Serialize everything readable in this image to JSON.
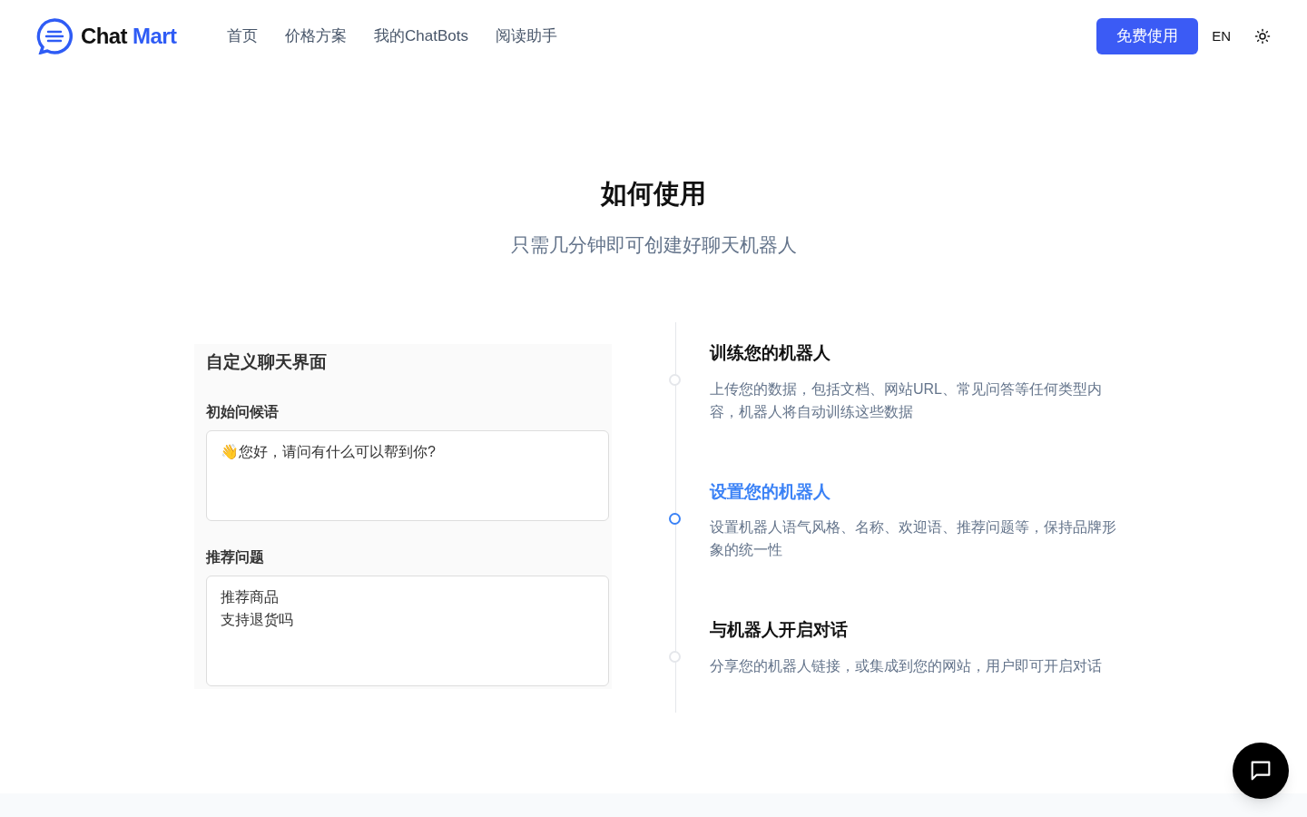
{
  "header": {
    "logo": {
      "word_1": "Chat",
      "word_2": "Mart"
    },
    "nav": [
      {
        "label": "首页"
      },
      {
        "label": "价格方案"
      },
      {
        "label": "我的ChatBots"
      },
      {
        "label": "阅读助手"
      }
    ],
    "cta": "免费使用",
    "language": "EN"
  },
  "section": {
    "title": "如何使用",
    "subtitle": "只需几分钟即可创建好聊天机器人"
  },
  "preview": {
    "title": "自定义聊天界面",
    "fields": [
      {
        "label": "初始问候语",
        "lines": [
          "👋您好，请问有什么可以帮到你?"
        ]
      },
      {
        "label": "推荐问题",
        "lines": [
          "推荐商品",
          "支持退货吗"
        ]
      }
    ]
  },
  "steps": [
    {
      "title": "训练您的机器人",
      "description": "上传您的数据，包括文档、网站URL、常见问答等任何类型内容，机器人将自动训练这些数据",
      "selected": false
    },
    {
      "title": "设置您的机器人",
      "description": "设置机器人语气风格、名称、欢迎语、推荐问题等，保持品牌形象的统一性",
      "selected": true
    },
    {
      "title": "与机器人开启对话",
      "description": "分享您的机器人链接，或集成到您的网站，用户即可开启对话",
      "selected": false
    }
  ]
}
